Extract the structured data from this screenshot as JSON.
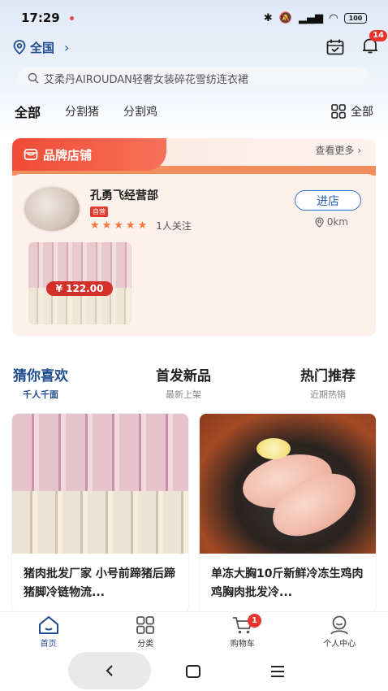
{
  "status_bar": {
    "time": "17:29",
    "battery": "100"
  },
  "location": {
    "label": "全国",
    "notification_count": "14"
  },
  "search": {
    "placeholder": "艾柔丹AIROUDAN轻奢女装碎花雪纺连衣裙"
  },
  "categories": {
    "items": [
      "全部",
      "分割猪",
      "分割鸡"
    ],
    "all_label": "全部"
  },
  "brand_store": {
    "section_title": "品牌店铺",
    "more_label": "查看更多",
    "shop_name": "孔勇飞经营部",
    "self_operated_tag": "自营",
    "rating_stars": 5,
    "followers": "1人关注",
    "enter_label": "进店",
    "distance": "0km",
    "product_price": "¥ 122.00"
  },
  "section_tabs": [
    {
      "title": "猜你喜欢",
      "sub": "千人千面"
    },
    {
      "title": "首发新品",
      "sub": "最新上架"
    },
    {
      "title": "热门推荐",
      "sub": "近期热销"
    }
  ],
  "products": [
    {
      "title": "猪肉批发厂家 小号前蹄猪后蹄 猪脚冷链物流..."
    },
    {
      "title": "单冻大胸10斤新鲜冷冻生鸡肉鸡胸肉批发冷..."
    }
  ],
  "bottom_nav": {
    "items": [
      "首页",
      "分类",
      "购物车",
      "个人中心"
    ],
    "cart_count": "1"
  },
  "colors": {
    "accent": "#1f4d8f",
    "brand_red": "#f04b35",
    "price_red": "#d3302a"
  }
}
